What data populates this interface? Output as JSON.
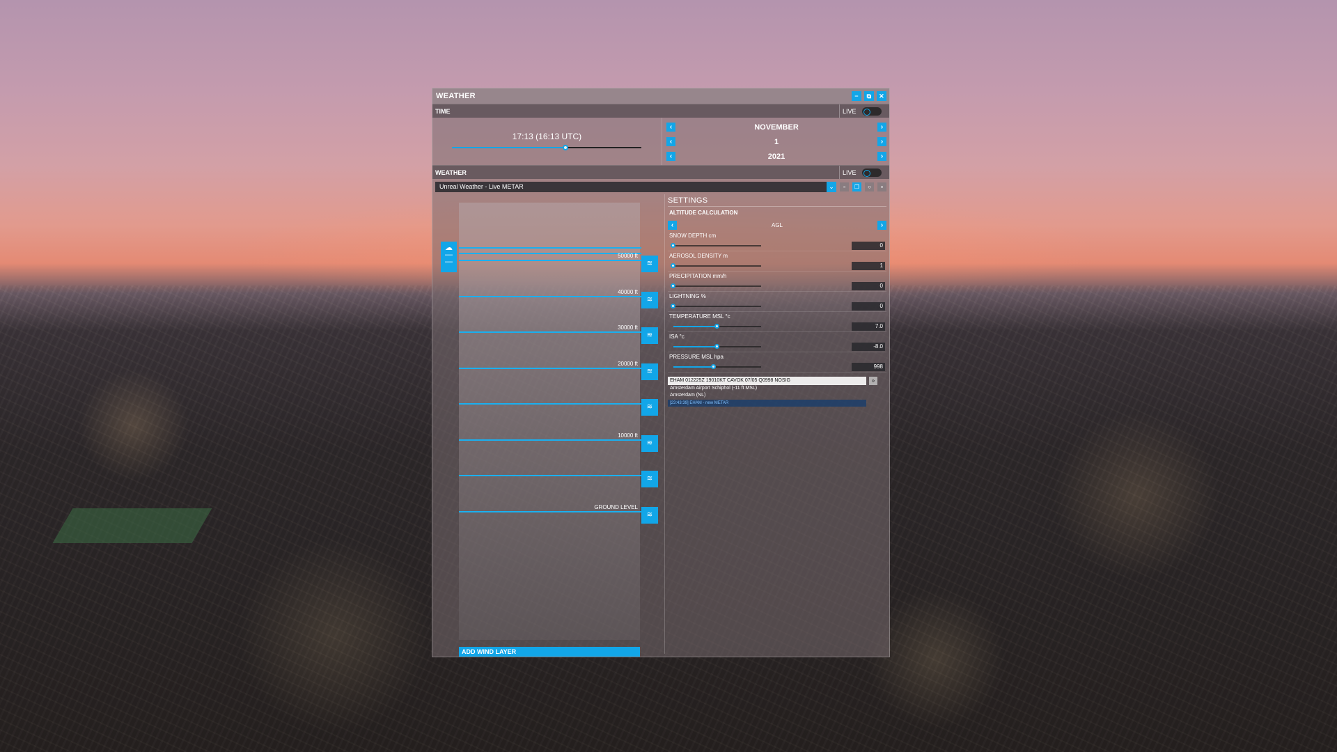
{
  "window": {
    "title": "WEATHER",
    "controls": {
      "minimize": "−",
      "popout": "⧉",
      "close": "✕"
    }
  },
  "time": {
    "section_label": "TIME",
    "live_label": "LIVE",
    "clock": "17:13 (16:13 UTC)",
    "time_slider_value": 0.6,
    "month": "NOVEMBER",
    "day": "1",
    "year": "2021"
  },
  "weather": {
    "section_label": "WEATHER",
    "live_label": "LIVE",
    "preset": "Unreal Weather - Live METAR"
  },
  "layers": {
    "altitude_labels": [
      "50000 ft",
      "40000 ft",
      "30000 ft",
      "20000 ft",
      "",
      "10000 ft",
      "",
      "GROUND LEVEL"
    ],
    "add_wind_label": "ADD WIND LAYER"
  },
  "settings": {
    "title": "SETTINGS",
    "altitude_calc_label": "ALTITUDE CALCULATION",
    "altitude_calc_value": "AGL",
    "items": [
      {
        "label": "SNOW DEPTH cm",
        "value": "0",
        "level": 0.0
      },
      {
        "label": "AEROSOL DENSITY m",
        "value": "1",
        "level": 0.0
      },
      {
        "label": "PRECIPITATION mm/h",
        "value": "0",
        "level": 0.0
      },
      {
        "label": "LIGHTNING %",
        "value": "0",
        "level": 0.0
      },
      {
        "label": "TEMPERATURE MSL °c",
        "value": "7.0",
        "level": 0.5
      },
      {
        "label": "ISA °c",
        "value": "-8.0",
        "level": 0.5
      },
      {
        "label": "PRESSURE MSL hpa",
        "value": "998",
        "level": 0.46
      }
    ],
    "metar": "EHAM 012225Z 19010KT CAVOK 07/05 Q0998 NOSIG",
    "station_line1": "Amsterdam Airport Schiphol (-11 ft MSL)",
    "station_line2": "Amsterdam (NL)",
    "log_line": "[23:43:39] EHAM - new METAR"
  },
  "colors": {
    "accent": "#12a6e8"
  }
}
